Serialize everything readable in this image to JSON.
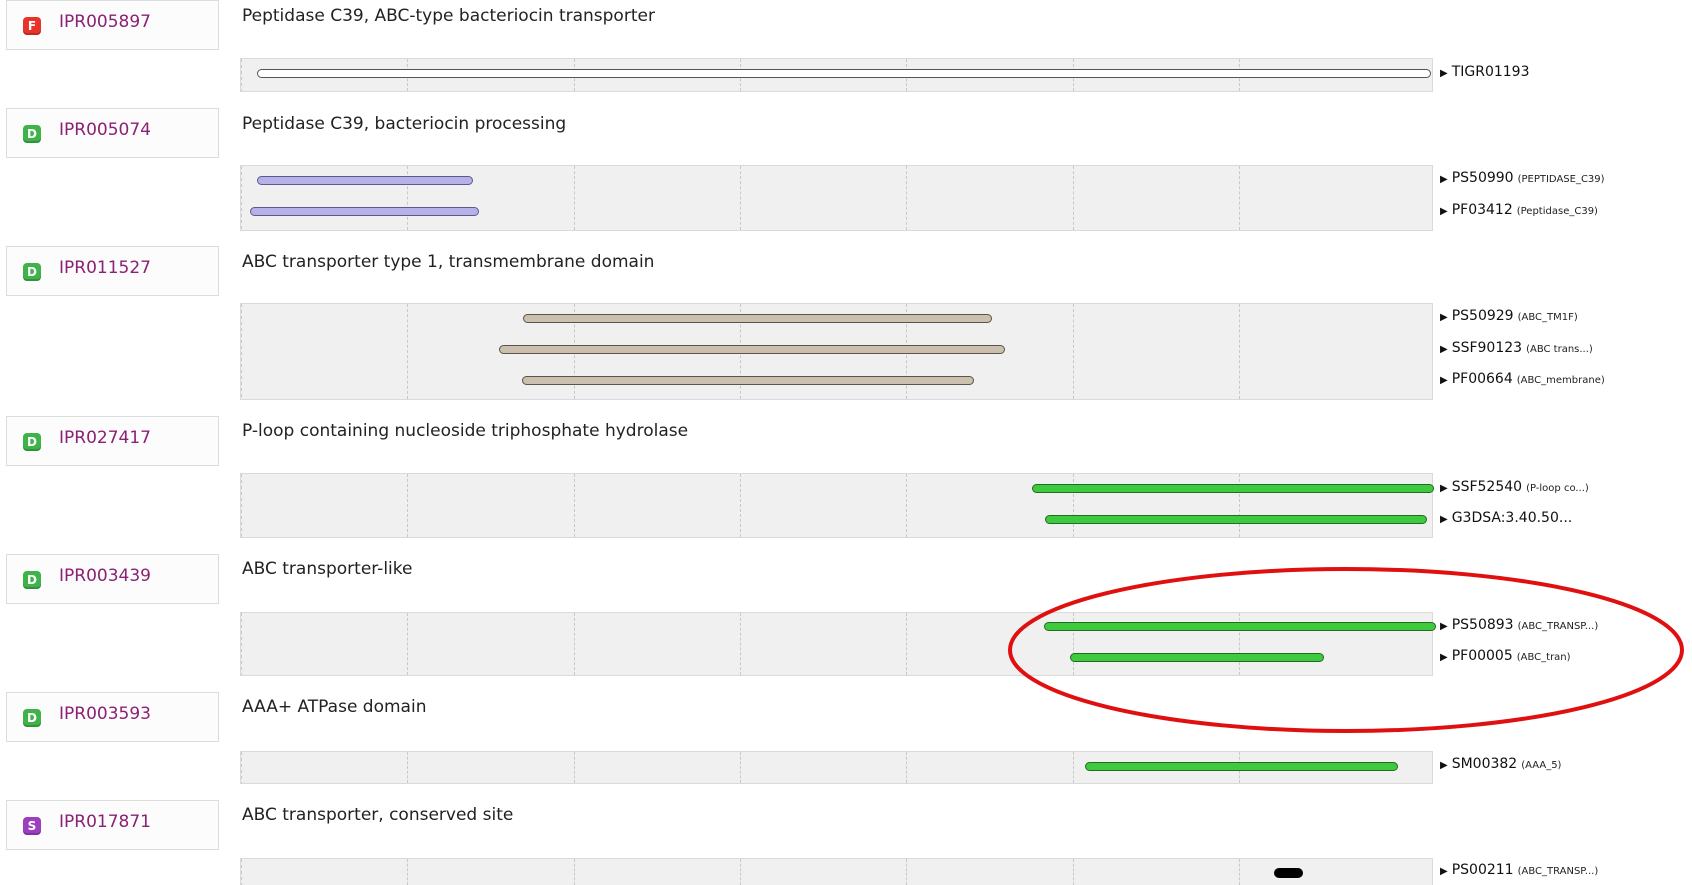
{
  "entries": [
    {
      "badge": "F",
      "id": "IPR005897",
      "title": "Peptidase C39, ABC-type bacteriocin transporter",
      "signatures": [
        {
          "acc": "TIGR01193",
          "name": ""
        }
      ]
    },
    {
      "badge": "D",
      "id": "IPR005074",
      "title": "Peptidase C39, bacteriocin processing",
      "signatures": [
        {
          "acc": "PS50990",
          "name": "(PEPTIDASE_C39)"
        },
        {
          "acc": "PF03412",
          "name": "(Peptidase_C39)"
        }
      ]
    },
    {
      "badge": "D",
      "id": "IPR011527",
      "title": "ABC transporter type 1, transmembrane domain",
      "signatures": [
        {
          "acc": "PS50929",
          "name": "(ABC_TM1F)"
        },
        {
          "acc": "SSF90123",
          "name": "(ABC trans...)"
        },
        {
          "acc": "PF00664",
          "name": "(ABC_membrane)"
        }
      ]
    },
    {
      "badge": "D",
      "id": "IPR027417",
      "title": "P-loop containing nucleoside triphosphate hydrolase",
      "signatures": [
        {
          "acc": "SSF52540",
          "name": "(P-loop co...)"
        },
        {
          "acc": "G3DSA:3.40.50...",
          "name": ""
        }
      ]
    },
    {
      "badge": "D",
      "id": "IPR003439",
      "title": "ABC transporter-like",
      "signatures": [
        {
          "acc": "PS50893",
          "name": "(ABC_TRANSP...)"
        },
        {
          "acc": "PF00005",
          "name": "(ABC_tran)"
        }
      ]
    },
    {
      "badge": "D",
      "id": "IPR003593",
      "title": "AAA+ ATPase domain",
      "signatures": [
        {
          "acc": "SM00382",
          "name": "(AAA_5)"
        }
      ]
    },
    {
      "badge": "S",
      "id": "IPR017871",
      "title": "ABC transporter, conserved site",
      "signatures": [
        {
          "acc": "PS00211",
          "name": "(ABC_TRANSP...)"
        }
      ]
    }
  ],
  "colors": {
    "family_badge": "#e8332a",
    "domain_badge": "#3fb34a",
    "site_badge": "#9b3fbf",
    "link": "#8b2174",
    "annotation_ellipse": "#e01010"
  }
}
